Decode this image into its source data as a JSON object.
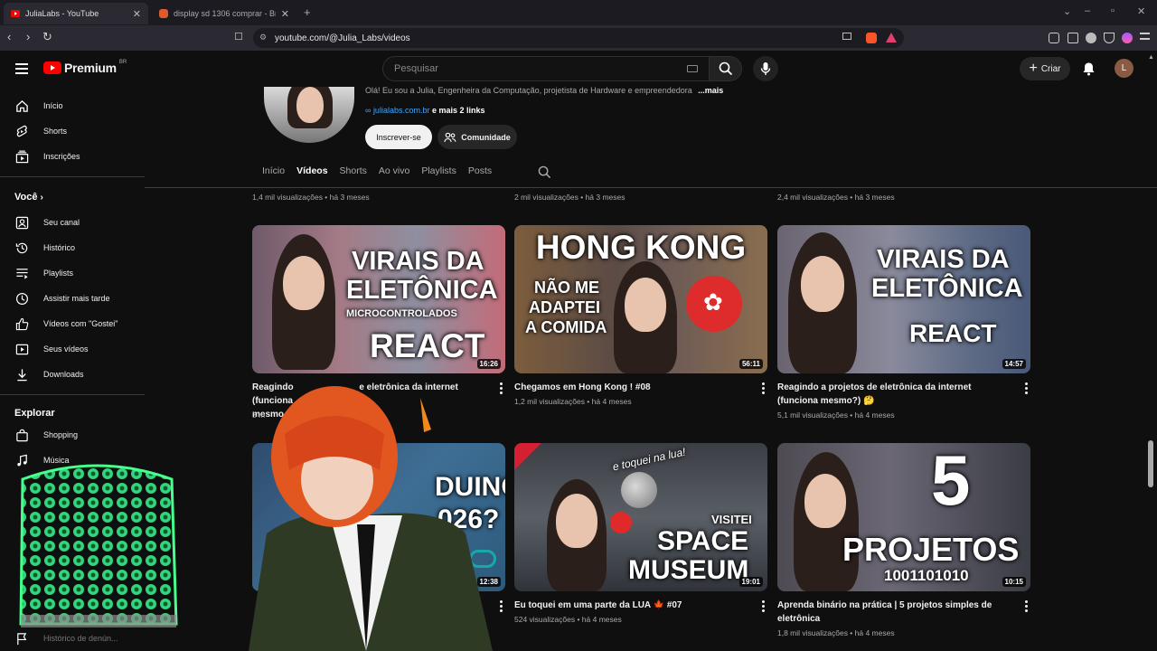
{
  "browser": {
    "tabs": [
      {
        "label": "JuliaLabs - YouTube"
      },
      {
        "label": "display sd 1306 comprar - Brave Sear"
      }
    ],
    "url": "youtube.com/@Julia_Labs/videos"
  },
  "header": {
    "logo_word": "Premium",
    "logo_region": "BR",
    "search_placeholder": "Pesquisar",
    "create_label": "Criar",
    "avatar_letter": "L"
  },
  "sidebar": {
    "top": [
      {
        "label": "Início",
        "icon": "home-icon"
      },
      {
        "label": "Shorts",
        "icon": "shorts-icon"
      },
      {
        "label": "Inscrições",
        "icon": "subscriptions-icon"
      }
    ],
    "you_heading": "Você",
    "you": [
      {
        "label": "Seu canal",
        "icon": "channel-icon"
      },
      {
        "label": "Histórico",
        "icon": "history-icon"
      },
      {
        "label": "Playlists",
        "icon": "playlists-icon"
      },
      {
        "label": "Assistir mais tarde",
        "icon": "watch-later-icon"
      },
      {
        "label": "Vídeos com \"Gostei\"",
        "icon": "like-icon"
      },
      {
        "label": "Seus vídeos",
        "icon": "your-videos-icon"
      },
      {
        "label": "Downloads",
        "icon": "download-icon"
      }
    ],
    "explore_heading": "Explorar",
    "explore": [
      {
        "label": "Shopping",
        "icon": "shopping-icon"
      },
      {
        "label": "Música",
        "icon": "music-icon"
      }
    ],
    "bottom_item": "Histórico de denún..."
  },
  "channel": {
    "description": "Olá! Eu sou a Julia, Engenheira da Computação, projetista de Hardware e empreendedora",
    "more": "...mais",
    "link": "julialabs.com.br",
    "more_links": "e mais 2 links",
    "subscribe": "Inscrever-se",
    "community": "Comunidade",
    "tabs": [
      "Início",
      "Vídeos",
      "Shorts",
      "Ao vivo",
      "Playlists",
      "Posts"
    ],
    "active_tab": "Vídeos"
  },
  "row0_meta": [
    "1,4 mil visualizações • há 3 meses",
    "2 mil visualizações • há 3 meses",
    "2,4 mil visualizações • há 3 meses"
  ],
  "videos": [
    {
      "thumb_lines": [
        "VIRAIS DA",
        "ELETÔNICA",
        "MICROCONTROLADOS",
        "REACT"
      ],
      "duration": "16:26",
      "title_visible": "Reagindo",
      "title_rest": "e eletrônica da internet (funciona",
      "title_line2": "mesmo",
      "meta": "3 m"
    },
    {
      "thumb_lines": [
        "HONG KONG",
        "NÃO ME",
        "ADAPTEI",
        "A COMIDA"
      ],
      "duration": "56:11",
      "title": "Chegamos em Hong Kong ! #08",
      "meta": "1,2 mil visualizações • há 4 meses"
    },
    {
      "thumb_lines": [
        "VIRAIS DA",
        "ELETÔNICA",
        "REACT"
      ],
      "duration": "14:57",
      "title": "Reagindo a projetos de eletrônica da internet (funciona mesmo?) 🤔",
      "meta": "5,1 mil visualizações • há 4 meses"
    },
    {
      "thumb_lines": [
        "DUINO",
        "026?"
      ],
      "duration": "12:38",
      "title": "",
      "meta": ""
    },
    {
      "thumb_lines": [
        "e toquei na lua!",
        "VISITEI",
        "SPACE",
        "MUSEUM"
      ],
      "duration": "19:01",
      "title": "Eu toquei em uma parte da LUA 🍁 #07",
      "meta": "524 visualizações • há 4 meses"
    },
    {
      "thumb_lines": [
        "5",
        "PROJETOS",
        "1001101010"
      ],
      "duration": "10:15",
      "title": "Aprenda binário na prática | 5 projetos simples de eletrônica",
      "meta": "1,8 mil visualizações • há 4 meses"
    }
  ]
}
